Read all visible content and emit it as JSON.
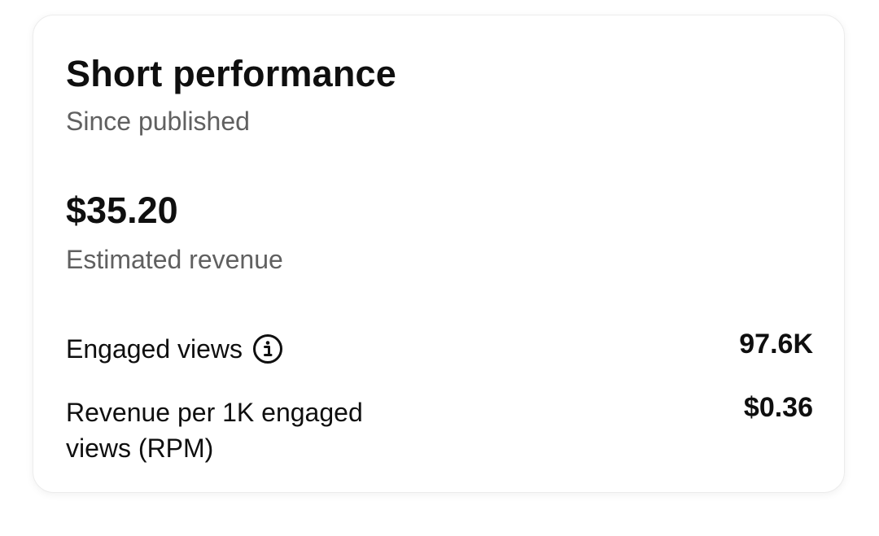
{
  "card": {
    "title": "Short performance",
    "subtitle": "Since published"
  },
  "revenue": {
    "value": "$35.20",
    "label": "Estimated revenue"
  },
  "metrics": [
    {
      "label": "Engaged views",
      "value": "97.6K",
      "icon": "info-icon"
    },
    {
      "label": "Revenue per 1K engaged views (RPM)",
      "value": "$0.36"
    }
  ]
}
